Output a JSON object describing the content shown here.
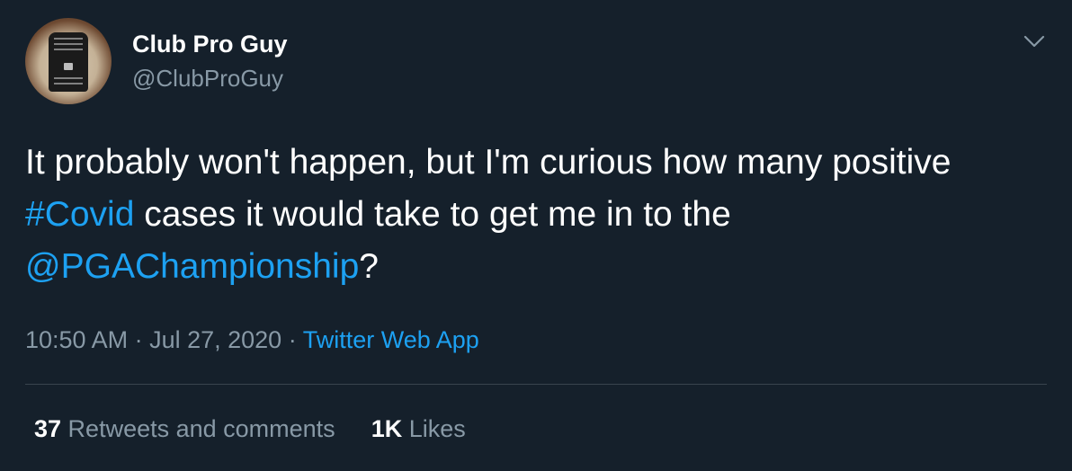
{
  "user": {
    "display_name": "Club Pro Guy",
    "handle": "@ClubProGuy"
  },
  "tweet": {
    "text_part1": "It probably won't happen, but I'm curious how many positive ",
    "hashtag": "#Covid",
    "text_part2": " cases it would take to get me in to the ",
    "mention": "@PGAChampionship",
    "text_part3": "?"
  },
  "meta": {
    "time": "10:50 AM",
    "separator1": " · ",
    "date": "Jul 27, 2020",
    "separator2": " · ",
    "source": "Twitter Web App"
  },
  "stats": {
    "retweets_count": "37",
    "retweets_label": " Retweets and comments",
    "likes_count": "1K",
    "likes_label": " Likes"
  },
  "colors": {
    "background": "#15202b",
    "link": "#1da1f2",
    "muted": "#8899a6",
    "divider": "#38444d"
  },
  "icons": {
    "menu": "chevron-down-icon"
  }
}
